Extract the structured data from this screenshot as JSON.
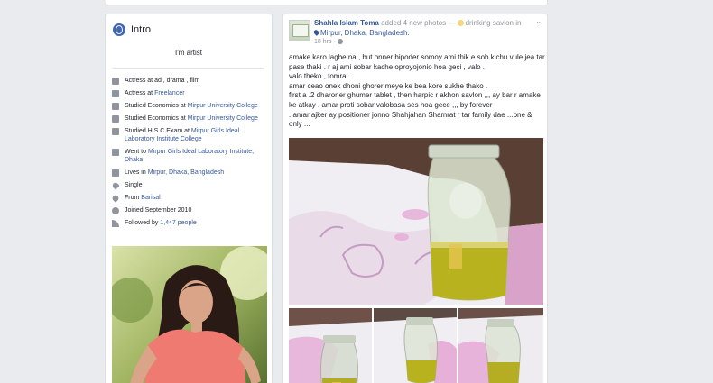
{
  "intro": {
    "title": "Intro",
    "bio": "I'm artist",
    "items": [
      {
        "icon": "briefcase-icon",
        "parts": [
          {
            "t": "Actress at ad , drama , film",
            "link": false
          }
        ]
      },
      {
        "icon": "briefcase-icon",
        "parts": [
          {
            "t": "Actress at ",
            "link": false
          },
          {
            "t": "Freelancer",
            "link": true
          }
        ]
      },
      {
        "icon": "graduation-cap-icon",
        "parts": [
          {
            "t": "Studied Economics at ",
            "link": false
          },
          {
            "t": "Mirpur University College",
            "link": true
          }
        ]
      },
      {
        "icon": "graduation-cap-icon",
        "parts": [
          {
            "t": "Studied Economics at ",
            "link": false
          },
          {
            "t": "Mirpur University College",
            "link": true
          }
        ]
      },
      {
        "icon": "graduation-cap-icon",
        "parts": [
          {
            "t": "Studied H.S.C Exam at ",
            "link": false
          },
          {
            "t": "Mirpur Girls Ideal Laboratory Institute College",
            "link": true
          }
        ]
      },
      {
        "icon": "graduation-cap-icon",
        "parts": [
          {
            "t": "Went to ",
            "link": false
          },
          {
            "t": "Mirpur Girls Ideal Laboratory Institute, Dhaka",
            "link": true
          }
        ]
      },
      {
        "icon": "home-icon",
        "parts": [
          {
            "t": "Lives in ",
            "link": false
          },
          {
            "t": "Mirpur, Dhaka, Bangladesh",
            "link": true
          }
        ]
      },
      {
        "icon": "heart-icon",
        "parts": [
          {
            "t": "Single",
            "link": false
          }
        ]
      },
      {
        "icon": "location-pin-icon",
        "parts": [
          {
            "t": "From ",
            "link": false
          },
          {
            "t": "Barisal",
            "link": true
          }
        ]
      },
      {
        "icon": "clock-icon",
        "parts": [
          {
            "t": "Joined September 2010",
            "link": false
          }
        ]
      },
      {
        "icon": "rss-icon",
        "parts": [
          {
            "t": "Followed by ",
            "link": false
          },
          {
            "t": "1,447 people",
            "link": true
          }
        ]
      }
    ]
  },
  "post": {
    "author": "Shahla Islam Toma",
    "action": " added 4 new photos — ",
    "feeling": "drinking savlon in",
    "location": "Mirpur, Dhaka, Bangladesh.",
    "time": "18 hrs",
    "privacy_icon": "globe-icon",
    "menu_icon": "chevron-down-icon",
    "text_lines": [
      "amake karo lagbe na , but onner bipoder somoy ami thik e sob kichu vule jea tar pase thaki . r aj ami sobar kache oproyojonio hoa geci , valo .",
      "valo theko , tomra .",
      "amar ceao onek dhoni ghorer meye ke bea kore sukhe thako .",
      "first a .2 dharoner ghumer tablet , then harpic r akhon savlon ,,, ay bar r amake ke atkay . amar proti sobar valobasa ses hoa gece ,,, by forever",
      "..amar ajker ay positioner jonno Shahjahan Shamrat r tar family dae ...one & only ..."
    ]
  },
  "colors": {
    "link": "#365899",
    "background": "#e9ebee",
    "muted": "#90949c"
  }
}
